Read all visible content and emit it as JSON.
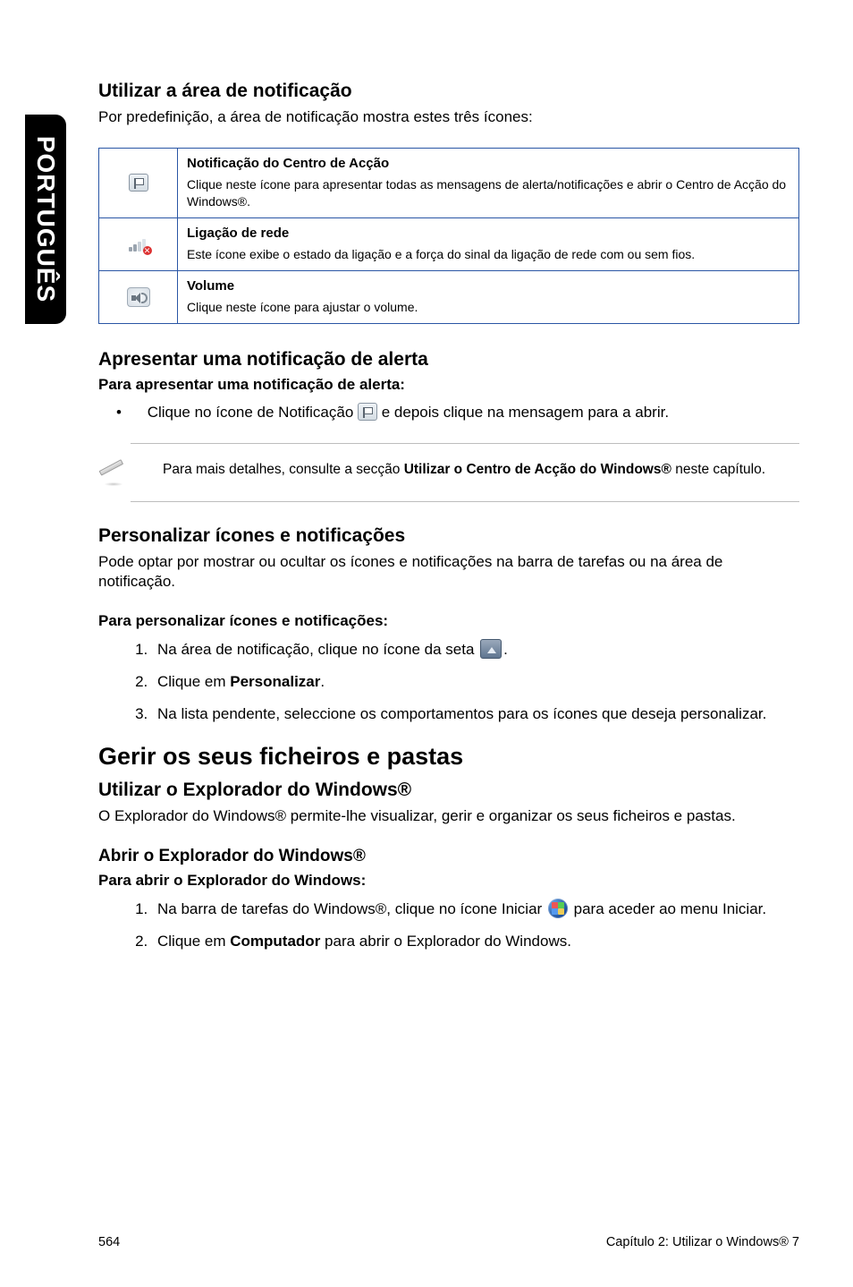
{
  "side_label": "PORTUGUÊS",
  "section1": {
    "title": "Utilizar a área de notificação",
    "intro": "Por predefinição, a área de notificação mostra estes três ícones:"
  },
  "table": {
    "rows": [
      {
        "title": "Notificação do Centro de Acção",
        "desc": "Clique neste ícone para apresentar todas as mensagens de alerta/notificações e abrir o Centro de Acção do Windows®."
      },
      {
        "title": "Ligação de rede",
        "desc": "Este ícone exibe o estado da ligação e a força do sinal da ligação de rede com ou sem fios."
      },
      {
        "title": "Volume",
        "desc": "Clique neste ícone para ajustar o volume."
      }
    ]
  },
  "alert": {
    "title": "Apresentar uma notificação de alerta",
    "procedure": "Para apresentar uma notificação de alerta:",
    "bullet_pre": "Clique no ícone de Notificação ",
    "bullet_post": " e depois clique na mensagem para a abrir."
  },
  "note": {
    "pre": "Para mais detalhes, consulte a secção ",
    "bold": "Utilizar o Centro de Acção do Windows®",
    "post": " neste capítulo."
  },
  "personalize": {
    "title": "Personalizar ícones e notificações",
    "intro": "Pode optar por mostrar ou ocultar os ícones e notificações na barra de tarefas ou na área de notificação.",
    "procedure": "Para personalizar ícones e notificações:",
    "step1_pre": "Na área de notificação, clique no ícone da seta ",
    "step1_post": ".",
    "step2_pre": "Clique em ",
    "step2_bold": "Personalizar",
    "step2_post": ".",
    "step3": "Na lista pendente, seleccione os comportamentos para os ícones que deseja personalizar."
  },
  "manage": {
    "title": "Gerir os seus ficheiros e pastas",
    "sub1": "Utilizar o Explorador do Windows®",
    "sub1_text": "O Explorador do Windows® permite-lhe visualizar, gerir e organizar os seus ficheiros e pastas.",
    "sub2": "Abrir o Explorador do Windows®",
    "procedure": "Para abrir o Explorador do Windows:",
    "step1_pre": "Na barra de tarefas do Windows®, clique no ícone Iniciar ",
    "step1_post": " para aceder ao menu Iniciar.",
    "step2_pre": "Clique em ",
    "step2_bold": "Computador",
    "step2_post": " para abrir o Explorador do Windows."
  },
  "footer": {
    "page": "564",
    "chapter": "Capítulo 2: Utilizar o Windows® 7"
  }
}
